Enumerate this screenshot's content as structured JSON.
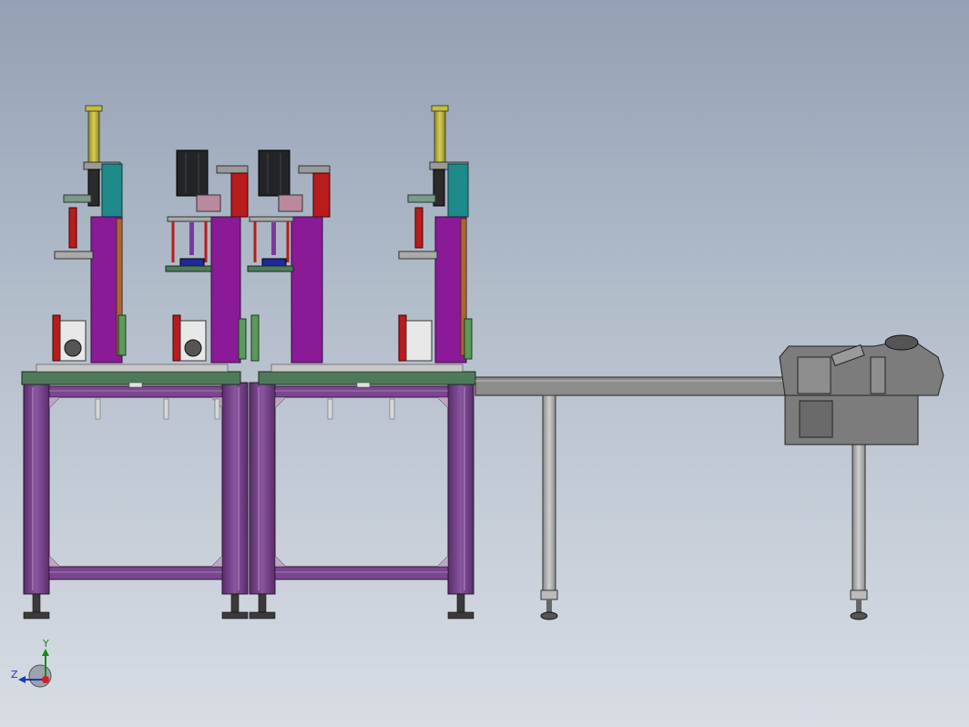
{
  "viewport": {
    "background_top": "#93a1b4",
    "background_bottom": "#d8dde4"
  },
  "colors": {
    "frame_purple": "#6a3a7e",
    "column_magenta": "#8a1a96",
    "plate_green": "#4e7a5a",
    "cylinder_yellow": "#b5a92e",
    "block_teal": "#1f8a8a",
    "accent_red": "#b81c1c",
    "motor_black": "#222426",
    "conveyor_gray": "#8c8c8c",
    "blue_part": "#1c2a9a"
  },
  "triad": {
    "y_label": "Y",
    "z_label": "Z"
  }
}
